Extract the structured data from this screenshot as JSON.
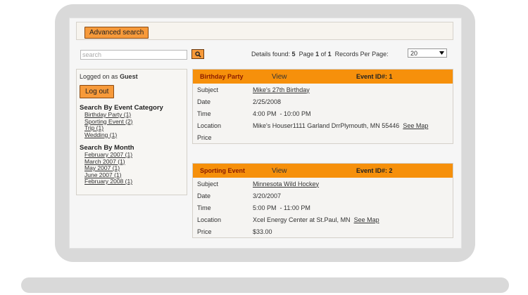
{
  "toolbar": {
    "advanced_search_label": "Advanced search"
  },
  "search": {
    "placeholder": "search",
    "details_prefix": "Details found: ",
    "details_count": "5",
    "page_prefix": "  Page ",
    "page_current": "1",
    "page_of": " of ",
    "page_total": "1",
    "records_per_page_label": "  Records Per Page: ",
    "records_per_page_value": "20"
  },
  "sidebar": {
    "logged_on_prefix": "Logged on as ",
    "user": "Guest",
    "logout_label": "Log out",
    "category_heading": "Search By Event Category",
    "categories": [
      "Birthday Party (1)",
      "Sporting Event (2)",
      "Trip (1)",
      "Wedding (1)"
    ],
    "month_heading": "Search By Month",
    "months": [
      "February 2007 (1)",
      "March 2007 (1)",
      "May 2007 (1)",
      "June 2007 (1)",
      "February 2008 (1)"
    ]
  },
  "events": [
    {
      "category": "Birthday Party",
      "view_label": "View",
      "event_id_label": "Event ID#: 1",
      "labels": [
        "Subject",
        "Date",
        "Time",
        "Location",
        "Price"
      ],
      "subject": "Mike's 27th Birthday",
      "date": "2/25/2008",
      "time": "4:00 PM  - 10:00 PM",
      "location": "Mike's Houser1111 Garland DrrPlymouth, MN 55446",
      "see_map": "See Map",
      "price": ""
    },
    {
      "category": "Sporting Event",
      "view_label": "View",
      "event_id_label": "Event ID#: 2",
      "labels": [
        "Subject",
        "Date",
        "Time",
        "Location",
        "Price"
      ],
      "subject": "Minnesota Wild Hockey",
      "date": "3/20/2007",
      "time": "5:00 PM  - 11:00 PM",
      "location": "Xcel Energy Center at St.Paul, MN",
      "see_map": "See Map",
      "price": "$33.00"
    }
  ],
  "colors": {
    "accent": "#f6900b",
    "button": "#f79a3a",
    "category_text": "#8a1b00"
  },
  "icons": {
    "search_button": "search-icon",
    "select_arrow": "dropdown-arrow-icon"
  }
}
